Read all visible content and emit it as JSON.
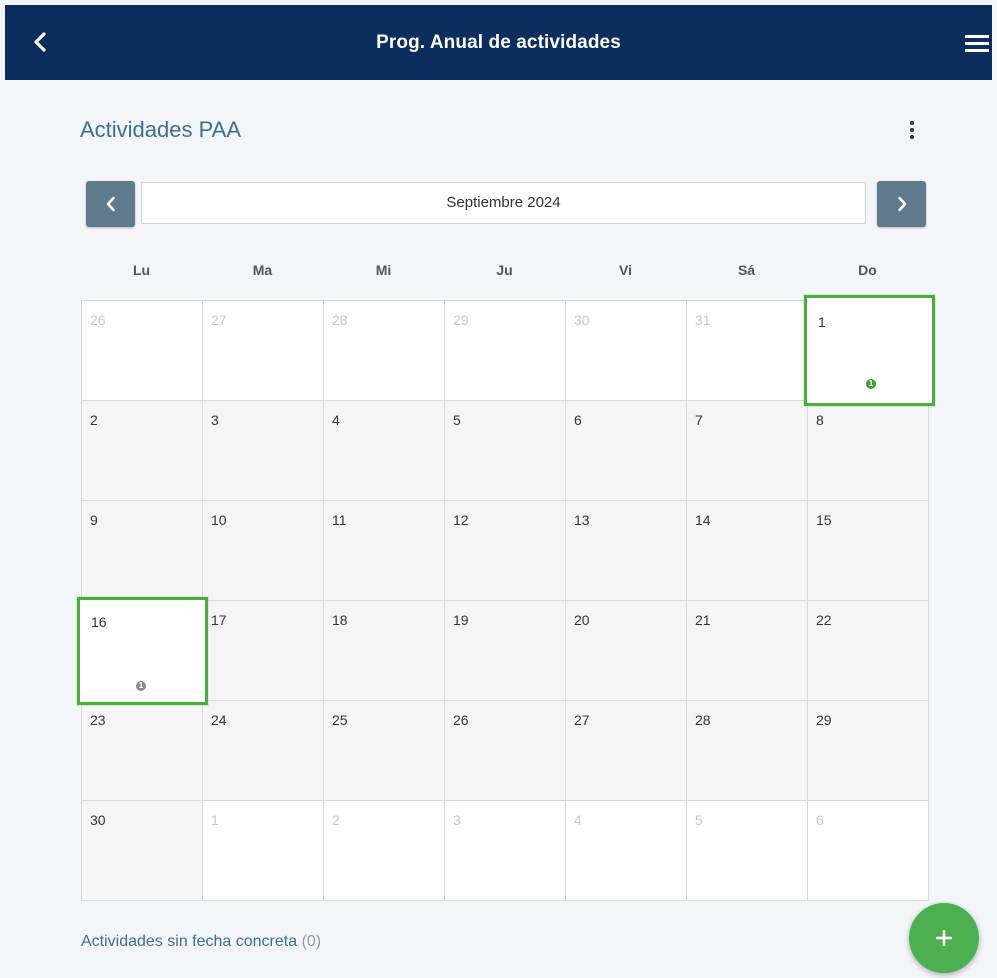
{
  "header": {
    "title": "Prog. Anual de actividades",
    "back_icon": "chevron-left-icon",
    "menu_icon": "hamburger-menu-icon"
  },
  "section": {
    "title": "Actividades PAA",
    "more_icon": "more-vertical-icon"
  },
  "month_nav": {
    "current": "Septiembre 2024",
    "prev_icon": "chevron-left-icon",
    "next_icon": "chevron-right-icon"
  },
  "weekdays": [
    "Lu",
    "Ma",
    "Mi",
    "Ju",
    "Vi",
    "Sá",
    "Do"
  ],
  "weeks": [
    [
      {
        "day": "26",
        "other": true
      },
      {
        "day": "27",
        "other": true
      },
      {
        "day": "28",
        "other": true
      },
      {
        "day": "29",
        "other": true
      },
      {
        "day": "30",
        "other": true
      },
      {
        "day": "31",
        "other": true
      },
      {
        "day": "1",
        "other": false,
        "highlight": true,
        "events": "1",
        "event_color": "#3f9e2f"
      }
    ],
    [
      {
        "day": "2"
      },
      {
        "day": "3"
      },
      {
        "day": "4"
      },
      {
        "day": "5"
      },
      {
        "day": "6"
      },
      {
        "day": "7"
      },
      {
        "day": "8"
      }
    ],
    [
      {
        "day": "9"
      },
      {
        "day": "10"
      },
      {
        "day": "11"
      },
      {
        "day": "12"
      },
      {
        "day": "13"
      },
      {
        "day": "14"
      },
      {
        "day": "15"
      }
    ],
    [
      {
        "day": "16",
        "highlight": true,
        "events": "1",
        "event_color": "#8a8a8a"
      },
      {
        "day": "17"
      },
      {
        "day": "18"
      },
      {
        "day": "19"
      },
      {
        "day": "20"
      },
      {
        "day": "21"
      },
      {
        "day": "22"
      }
    ],
    [
      {
        "day": "23"
      },
      {
        "day": "24"
      },
      {
        "day": "25"
      },
      {
        "day": "26"
      },
      {
        "day": "27"
      },
      {
        "day": "28"
      },
      {
        "day": "29"
      }
    ],
    [
      {
        "day": "30"
      },
      {
        "day": "1",
        "other": true
      },
      {
        "day": "2",
        "other": true
      },
      {
        "day": "3",
        "other": true
      },
      {
        "day": "4",
        "other": true
      },
      {
        "day": "5",
        "other": true
      },
      {
        "day": "6",
        "other": true
      }
    ]
  ],
  "footer": {
    "label": "Actividades sin fecha concreta",
    "count": "(0)"
  },
  "fab": {
    "icon": "plus-icon",
    "color": "#4caf50"
  },
  "colors": {
    "header_bg": "#0c2e5e",
    "accent_text": "#3b6f98",
    "highlight_border": "#4bad3e",
    "nav_button": "#5f7a8d"
  }
}
